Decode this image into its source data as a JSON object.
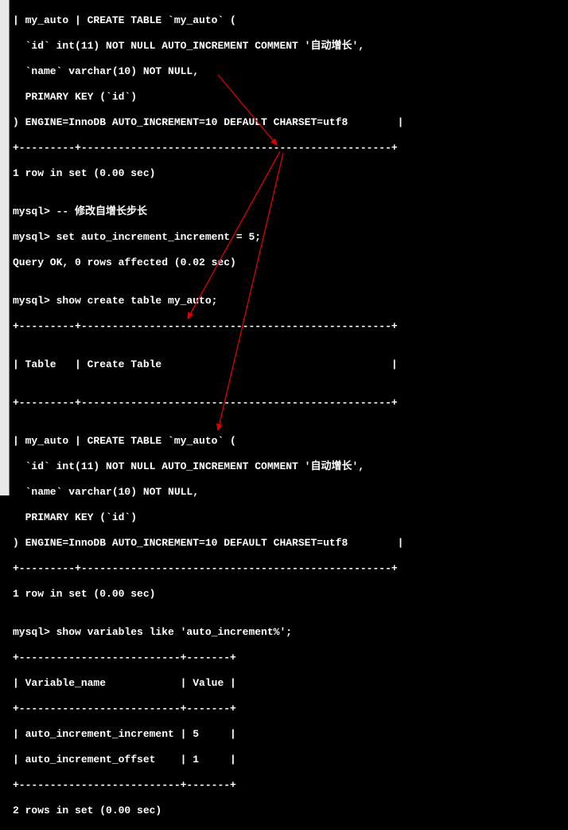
{
  "lines": {
    "l01": "| my_auto | CREATE TABLE `my_auto` (",
    "l02": "  `id` int(11) NOT NULL AUTO_INCREMENT COMMENT '自动增长',",
    "l03": "  `name` varchar(10) NOT NULL,",
    "l04": "  PRIMARY KEY (`id`)",
    "l05": ") ENGINE=InnoDB AUTO_INCREMENT=10 DEFAULT CHARSET=utf8        |",
    "l06": "+---------+--------------------------------------------------+",
    "l07": "1 row in set (0.00 sec)",
    "l08": "",
    "l09": "mysql> -- 修改自增长步长",
    "l10": "mysql> set auto_increment_increment = 5;",
    "l11": "Query OK, 0 rows affected (0.02 sec)",
    "l12": "",
    "l13": "mysql> show create table my_auto;",
    "l14": "+---------+--------------------------------------------------+",
    "l15": "",
    "l16": "| Table   | Create Table                                     |",
    "l17": "",
    "l18": "+---------+--------------------------------------------------+",
    "l19": "",
    "l20": "| my_auto | CREATE TABLE `my_auto` (",
    "l21": "  `id` int(11) NOT NULL AUTO_INCREMENT COMMENT '自动增长',",
    "l22": "  `name` varchar(10) NOT NULL,",
    "l23": "  PRIMARY KEY (`id`)",
    "l24": ") ENGINE=InnoDB AUTO_INCREMENT=10 DEFAULT CHARSET=utf8        |",
    "l25": "+---------+--------------------------------------------------+",
    "l26": "1 row in set (0.00 sec)",
    "l27": "",
    "l28": "mysql> show variables like 'auto_increment%';",
    "l29": "+--------------------------+-------+",
    "l30": "| Variable_name            | Value |",
    "l31": "+--------------------------+-------+",
    "l32": "| auto_increment_increment | 5     |",
    "l33": "| auto_increment_offset    | 1     |",
    "l34": "+--------------------------+-------+",
    "l35": "2 rows in set (0.00 sec)"
  },
  "annotations": {
    "arrow1_desc": "from AUTO_INCREMENT=10 top to set auto_increment_increment = 5",
    "arrow2_desc": "from set statement to AUTO_INCREMENT=10 second block",
    "arrow3_desc": "from set statement down to value 5 in variables table"
  },
  "colors": {
    "arrow": "#d00000",
    "bg": "#000000",
    "fg": "#ffffff"
  }
}
